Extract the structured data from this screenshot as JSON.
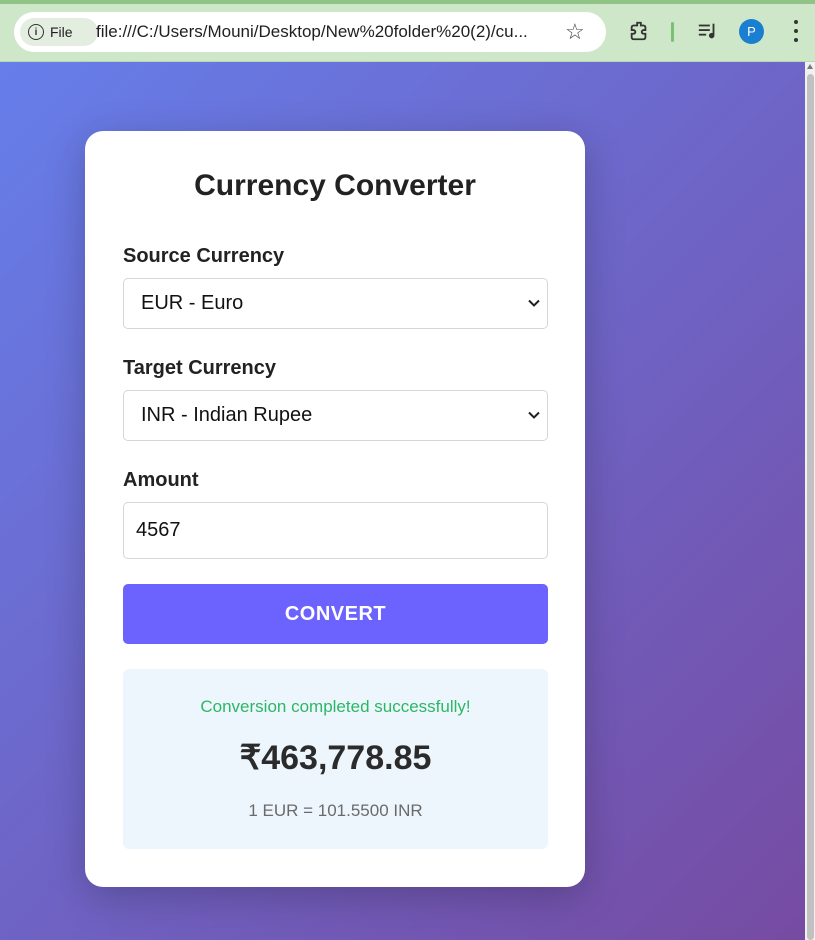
{
  "browser": {
    "site_chip_label": "File",
    "url": "file:///C:/Users/Mouni/Desktop/New%20folder%20(2)/cu...",
    "profile_initial": "P"
  },
  "converter": {
    "title": "Currency Converter",
    "source_label": "Source Currency",
    "source_value": "EUR - Euro",
    "target_label": "Target Currency",
    "target_value": "INR - Indian Rupee",
    "amount_label": "Amount",
    "amount_value": "4567",
    "convert_label": "CONVERT",
    "result": {
      "status": "Conversion completed successfully!",
      "amount": "₹463,778.85",
      "rate": "1 EUR = 101.5500 INR"
    }
  },
  "colors": {
    "gradient_start": "#667eea",
    "gradient_end": "#764ba2",
    "button": "#6c63ff",
    "success": "#2cb765",
    "result_bg": "#eef6fd"
  }
}
